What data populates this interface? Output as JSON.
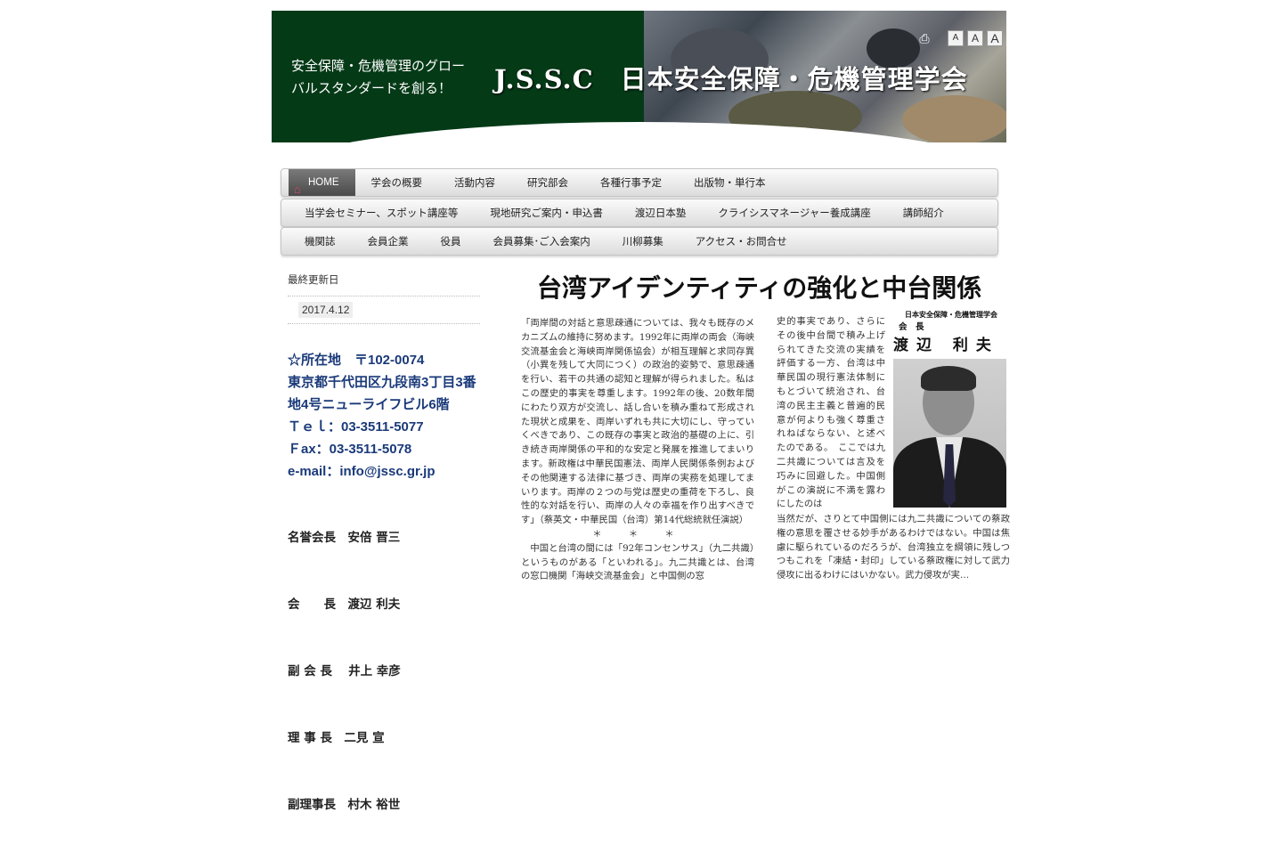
{
  "header": {
    "tagline_line1": "安全保障・危機管理のグロー",
    "tagline_line2": "バルスタンダードを創る！",
    "title": "J.S.S.C　日本安全保障・危機管理学会",
    "tools": {
      "print_icon": "printer-icon",
      "font_small": "A",
      "font_medium": "A",
      "font_large": "A"
    }
  },
  "nav": {
    "row1": [
      "HOME",
      "学会の概要",
      "活動内容",
      "研究部会",
      "各種行事予定",
      "出版物・単行本"
    ],
    "row2": [
      "当学会セミナー、スポット講座等",
      "現地研究ご案内・申込書",
      "渡辺日本塾",
      "クライシスマネージャー養成講座",
      "講師紹介"
    ],
    "row3": [
      "機関誌",
      "会員企業",
      "役員",
      "会員募集･ご入会案内",
      "川柳募集",
      "アクセス・お問合せ"
    ]
  },
  "sidebar": {
    "updated_label": "最終更新日",
    "updated_date": "2017.4.12",
    "address1": "☆所在地　〒102-0074",
    "address2": "東京都千代田区九段南3丁目3番",
    "address3": "地4号ニューライフビル6階",
    "tel": "Ｔｅｌ：03-3511-5077",
    "fax": "Ｆax：03-3511-5078",
    "email": "e-mail：info@jssc.gr.jp",
    "officers": [
      "名誉会長　安倍 晋三",
      "会　　長　渡辺 利夫",
      "副 会 長　 井上 幸彦",
      "理 事 長　二見 宣",
      "副理事長　村木 裕世"
    ]
  },
  "article": {
    "title": "台湾アイデンティティの強化と中台関係",
    "col1_p1": "「両岸間の対話と意思疎通については、我々も既存のメカニズムの維持に努めます。1992年に両岸の両会（海峡交流基金会と海峡両岸関係協会）が相互理解と求同存異（小異を残して大同につく）の政治的姿勢で、意思疎通を行い、若干の共通の認知と理解が得られました。私はこの歴史的事実を尊重します。1992年の後、20数年間にわたり双方が交流し、話し合いを積み重ねて形成された現状と成果を、両岸いずれも共に大切にし、守っていくべきであり、この既存の事実と政治的基礎の上に、引き続き両岸関係の平和的な安定と発展を推進してまいります。新政権は中華民国憲法、両岸人民関係条例およびその他関連する法律に基づき、両岸の実務を処理してまいります。両岸の２つの与党は歴史の重荷を下ろし、良性的な対話を行い、両岸の人々の幸福を作り出すべきです」（蔡英文・中華民国（台湾）第14代総統就任演説）",
    "separator": "＊　＊　＊",
    "col1_p2": "　中国と台湾の間には「92年コンセンサス」（九二共識）というものがある「といわれる」。九二共識とは、台湾の窓口機関「海峡交流基金会」と中国側の窓",
    "col2_text": "史的事実であり、さらにその後中台間で積み上げられてきた交流の実績を評価する一方、台湾は中華民国の現行憲法体制にもとづいて統治され、台湾の民主主義と普遍的民意が何よりも強く尊重されねばならない、と述べたのである。　ここでは九二共識については言及を巧みに回避した。中国側がこの演説に不満を露わにしたのは",
    "col3_text": "当然だが、さりとて中国側には九二共識についての蔡政権の意思を覆させる妙手があるわけではない。中国は焦慮に駆られているのだろうが、台湾独立を綱領に残しつつもこれを「凍結・封印」している蔡政権に対して武力侵攻に出るわけにはいかない。武力侵攻が実…",
    "author_org": "日本安全保障・危機管理学会",
    "author_role": "会　長",
    "author_name": "渡辺 利夫"
  }
}
